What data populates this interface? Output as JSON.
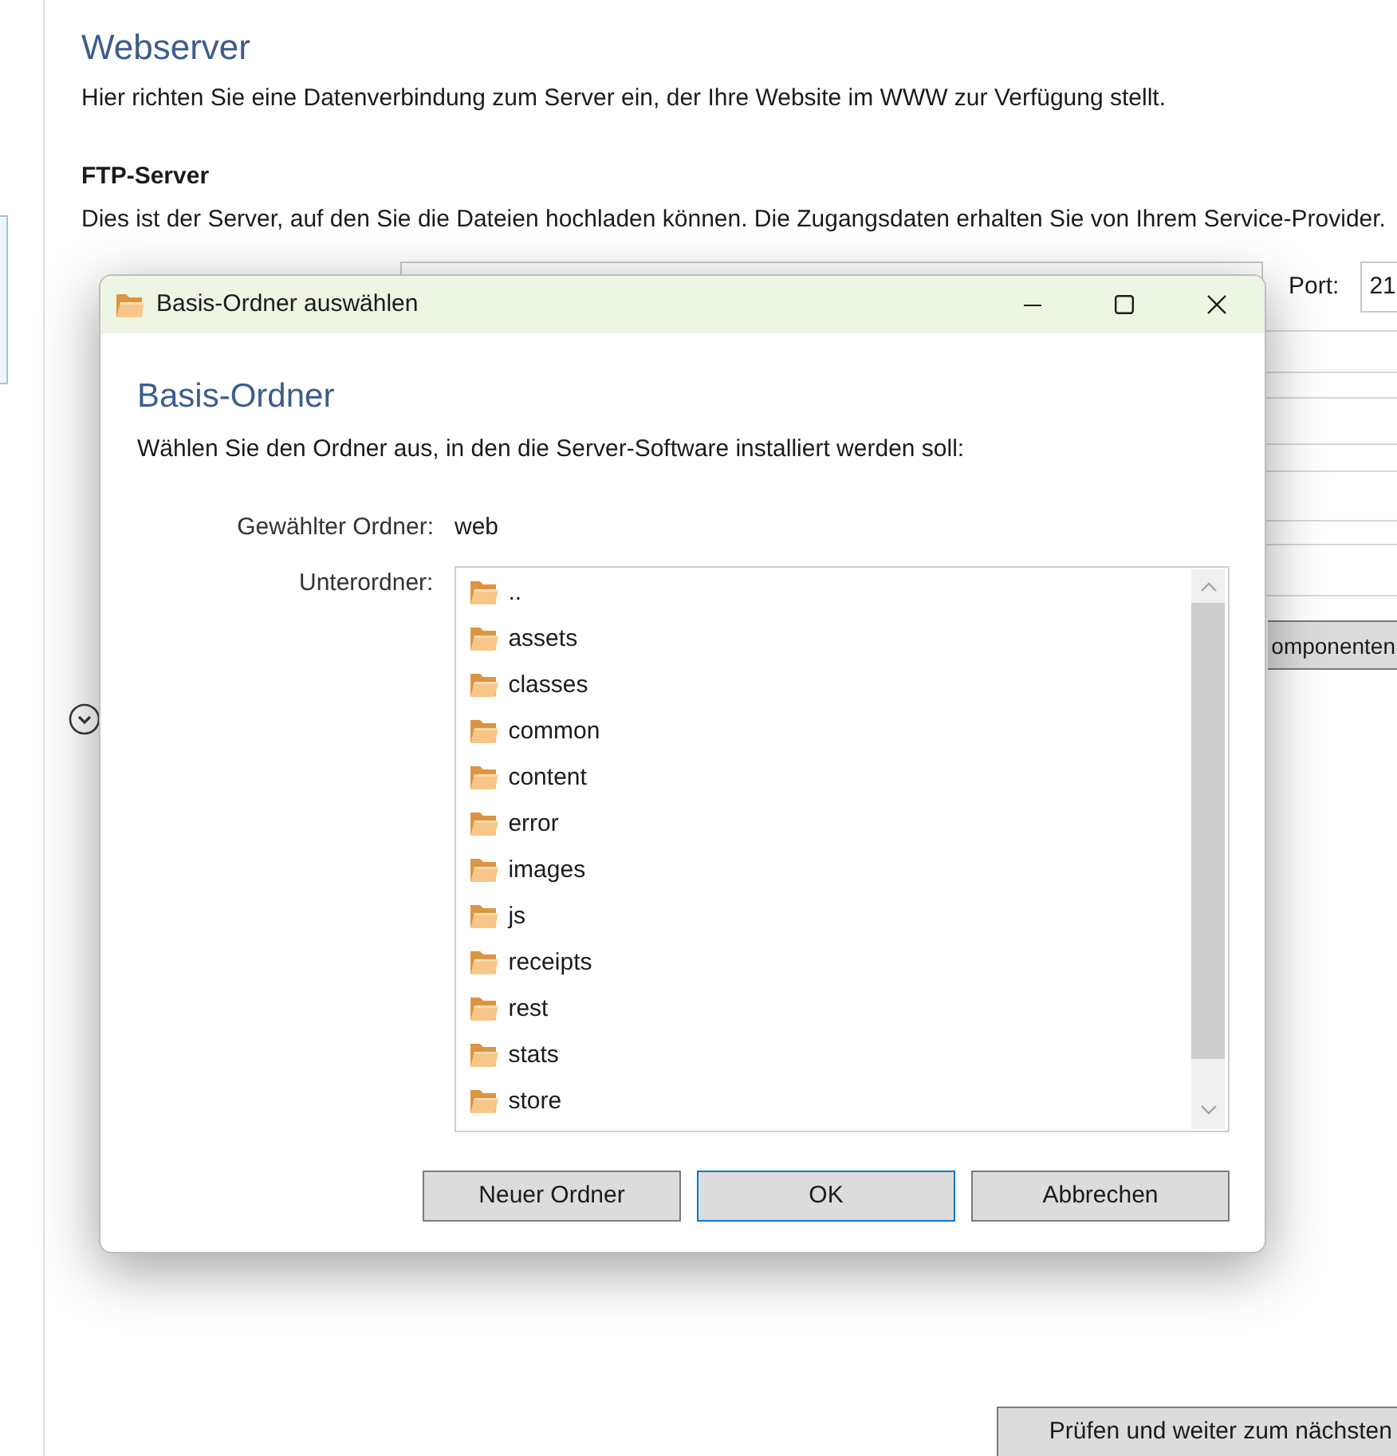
{
  "page": {
    "title": "Webserver",
    "intro": "Hier richten Sie eine Datenverbindung zum Server ein, der Ihre Website im WWW zur Verfügung stellt.",
    "section_title": "FTP-Server",
    "section_text": "Dies ist der Server, auf den Sie die Dateien hochladen können. Die Zugangsdaten erhalten Sie von Ihrem Service-Provider.",
    "port_label": "Port:",
    "port_value": "21",
    "components_button": "omponenten",
    "next_button": "Prüfen und weiter zum nächsten"
  },
  "dialog": {
    "title": "Basis-Ordner auswählen",
    "heading": "Basis-Ordner",
    "description": "Wählen Sie den Ordner aus, in den die Server-Software installiert werden soll:",
    "selected_folder_label": "Gewählter Ordner:",
    "selected_folder_value": "web",
    "subfolders_label": "Unterordner:",
    "subfolders": [
      "..",
      "assets",
      "classes",
      "common",
      "content",
      "error",
      "images",
      "js",
      "receipts",
      "rest",
      "stats",
      "store"
    ],
    "buttons": [
      {
        "label": "Neuer Ordner",
        "default": false
      },
      {
        "label": "OK",
        "default": true
      },
      {
        "label": "Abbrechen",
        "default": false
      }
    ]
  }
}
